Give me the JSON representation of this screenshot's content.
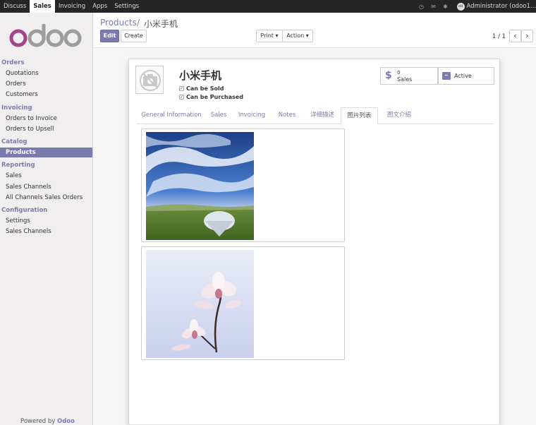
{
  "topbar": {
    "menus": [
      "Discuss",
      "Sales",
      "Invoicing",
      "Apps",
      "Settings"
    ],
    "active_menu": "Sales",
    "user": "Administrator (odoo1..."
  },
  "sidebar": {
    "sections": [
      {
        "title": "Orders",
        "items": [
          "Quotations",
          "Orders",
          "Customers"
        ]
      },
      {
        "title": "Invoicing",
        "items": [
          "Orders to Invoice",
          "Orders to Upsell"
        ]
      },
      {
        "title": "Catalog",
        "items": [
          "Products"
        ]
      },
      {
        "title": "Reporting",
        "items": [
          "Sales",
          "Sales Channels",
          "All Channels Sales Orders"
        ]
      },
      {
        "title": "Configuration",
        "items": [
          "Settings",
          "Sales Channels"
        ]
      }
    ],
    "active_item": "Products",
    "powered_prefix": "Powered by",
    "powered_brand": "Odoo"
  },
  "control_panel": {
    "breadcrumb_parent": "Products",
    "breadcrumb_sep": "/",
    "breadcrumb_current": "小米手机",
    "edit_label": "Edit",
    "create_label": "Create",
    "print_label": "Print",
    "action_label": "Action",
    "pager": "1 / 1",
    "prev_glyph": "‹",
    "next_glyph": "›"
  },
  "product": {
    "name": "小米手机",
    "can_be_sold": "Can be Sold",
    "can_be_purchased": "Can be Purchased",
    "sales_count": "0",
    "sales_label": "Sales",
    "active_label": "Active"
  },
  "tabs": [
    "General Information",
    "Sales",
    "Invoicing",
    "Notes",
    "详细描述",
    "图片列表",
    "图文介绍"
  ],
  "active_tab": "图片列表",
  "colors": {
    "accent": "#7c7bad",
    "topbar": "#252525"
  }
}
